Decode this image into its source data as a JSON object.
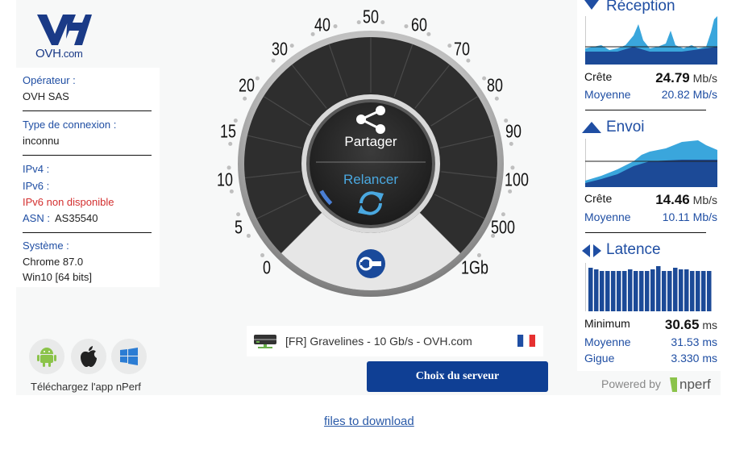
{
  "brand": {
    "logo_text_main": "OVH",
    "logo_text_sub": ".com"
  },
  "provider_info": {
    "operator_label": "Opérateur :",
    "operator_value": "OVH SAS",
    "connection_label": "Type de connexion :",
    "connection_value": "inconnu",
    "ipv4_label": "IPv4 :",
    "ipv6_label": "IPv6 :",
    "ipv6_value": "IPv6 non disponible",
    "asn_label": "ASN :",
    "asn_value": "AS35540",
    "system_label": "Système :",
    "browser_value": "Chrome 87.0",
    "os_value": "Win10 [64 bits]"
  },
  "apps": {
    "caption": "Téléchargez l'app nPerf",
    "icons": [
      "android-icon",
      "apple-icon",
      "windows-icon"
    ]
  },
  "gauge": {
    "ticks": [
      "0",
      "5",
      "10",
      "15",
      "20",
      "30",
      "40",
      "50",
      "60",
      "70",
      "80",
      "90",
      "100",
      "500",
      "1Gb"
    ],
    "share_label": "Partager",
    "restart_label": "Relancer",
    "progress_fraction": 0.06,
    "colors": {
      "face": "#2b2b2b",
      "accent": "#1f4ea3",
      "relancer": "#4aa8e0"
    }
  },
  "server": {
    "name": "[FR] Gravelines - 10 Gb/s - OVH.com",
    "choose_label": "Choix du serveur"
  },
  "reception": {
    "title": "Réception",
    "peak_label": "Crête",
    "peak_value": "24.79",
    "peak_unit": "Mb/s",
    "avg_label": "Moyenne",
    "avg_value": "20.82 Mb/s"
  },
  "upload": {
    "title": "Envoi",
    "peak_label": "Crête",
    "peak_value": "14.46",
    "peak_unit": "Mb/s",
    "avg_label": "Moyenne",
    "avg_value": "10.11 Mb/s"
  },
  "latency": {
    "title": "Latence",
    "min_label": "Minimum",
    "min_value": "30.65",
    "min_unit": "ms",
    "avg_label": "Moyenne",
    "avg_value": "31.53 ms",
    "jitter_label": "Gigue",
    "jitter_value": "3.330 ms"
  },
  "footer": {
    "powered_label": "Powered by",
    "nperf_logo": "nperf",
    "download_link": "files to download"
  },
  "colors": {
    "brand_blue": "#1f4ea3",
    "dark_blue": "#0f3f94",
    "light_blue": "#3aa6dc",
    "error_red": "#d32f2f"
  }
}
